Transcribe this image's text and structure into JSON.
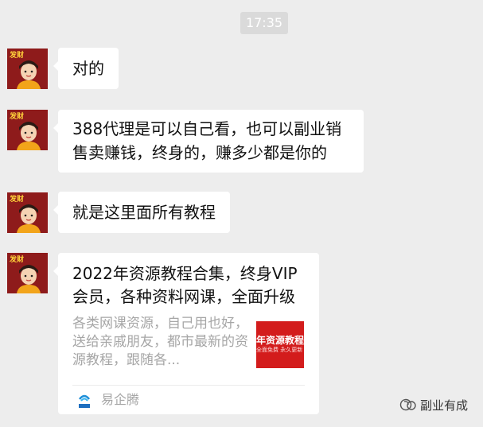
{
  "chat": {
    "timestamp": "17:35",
    "avatar_sticker_text": "发财",
    "messages": [
      {
        "lines": [
          "对的"
        ]
      },
      {
        "lines": [
          "388代理是可以自己看，也可以副业销",
          "售卖赚钱，终身的，赚多少都是你的"
        ]
      },
      {
        "lines": [
          "就是这里面所有教程"
        ]
      }
    ],
    "link_card": {
      "title": "2022年资源教程合集，终身VIP会员，各种资料网课，全面升级",
      "description": "各类网课资源，自己用也好，送给亲戚朋友，都市最新的资源教程，跟随各...",
      "thumbnail_title": "年资源教程",
      "thumbnail_subtitle": "全面免费 永久更新",
      "source_name": "易企腾",
      "source_logo_text": "易企腾"
    }
  },
  "watermark": {
    "label": "副业有成",
    "icon": "wechat-official-account-icon"
  },
  "colors": {
    "background": "#ededed",
    "bubble": "#ffffff",
    "thumbnail": "#d31c1c",
    "avatar": "#8e1b1b"
  }
}
